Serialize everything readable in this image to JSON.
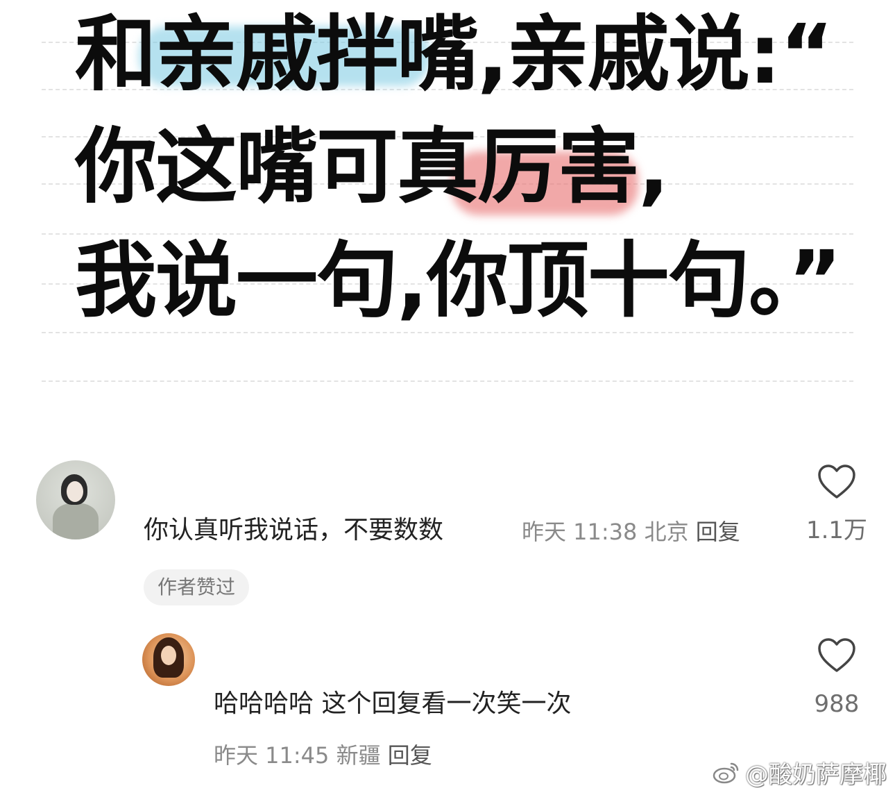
{
  "post": {
    "lines": [
      "和亲戚拌嘴,亲戚说:“",
      "你这嘴可真厉害,",
      "我说一句,你顶十句。”"
    ]
  },
  "comments": [
    {
      "text": "你认真听我说话，不要数数",
      "time": "昨天 11:38",
      "location": "北京",
      "reply_label": "回复",
      "likes": "1.1万",
      "badge": "作者赞过"
    },
    {
      "text": "哈哈哈哈 这个回复看一次笑一次",
      "time": "昨天 11:45",
      "location": "新疆",
      "reply_label": "回复",
      "likes": "988"
    }
  ],
  "watermark": {
    "text": "@酸奶萨摩椰",
    "icon": "weibo-icon"
  },
  "colors": {
    "highlight_blue": "#78c8e1",
    "highlight_red": "#e86e6e",
    "text_primary": "#222222",
    "text_secondary": "#8a8a8a"
  }
}
